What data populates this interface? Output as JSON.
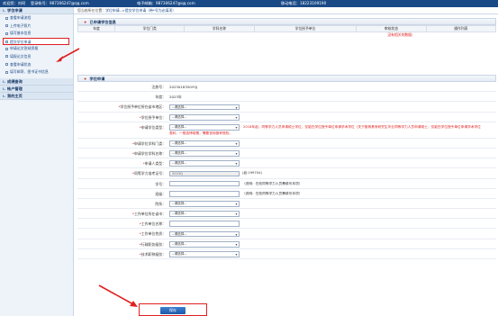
{
  "topbar": {
    "welcome": "欢迎您：刘珂",
    "account": "登录帐号：987306247@qq.com",
    "email": "电子邮箱：987306247@qq.com",
    "phone": "移动电话：18223109190"
  },
  "sidebar": {
    "sections": [
      {
        "label": "学位申请"
      },
      {
        "label": "成绩查询"
      },
      {
        "label": "帐户管理"
      },
      {
        "label": "我的主页"
      }
    ],
    "items": [
      {
        "label": "查看申请流程"
      },
      {
        "label": "上传电子照片"
      },
      {
        "label": "填写基本信息"
      },
      {
        "label": "提交学位申请"
      },
      {
        "label": "申请论文答辩资格"
      },
      {
        "label": "填报论文信息"
      },
      {
        "label": "查看申请状态"
      },
      {
        "label": "填写邮寄、图书证书信息"
      }
    ]
  },
  "breadcrumb": {
    "prefix": "您当前所在位置：",
    "path": "学位申请-->提交学位申请（带*号为必填项）"
  },
  "applied_panel": {
    "title": "已申请学位信息",
    "columns": [
      "年度",
      "学位门类",
      "学科名称",
      "学位授予单位",
      "审核状态",
      "操作列表"
    ],
    "empty_text": "没有相关的数据!"
  },
  "form": {
    "title": "学位申请",
    "fields": [
      {
        "label": "注册号：",
        "required": false,
        "value": "2023018350YQJ"
      },
      {
        "label": "年度：",
        "required": false,
        "value": "2023年"
      },
      {
        "label": "学位授予单位所在省市地区：",
        "required": true,
        "select": "--请选择--"
      },
      {
        "label": "学位授予单位：",
        "required": true,
        "select": "--请选择--"
      },
      {
        "label": "申请学位类型：",
        "required": true,
        "select": "--请选择--",
        "warn": "2016年起，同等学力人员申请硕士学位，仅能在学位授予单位申请学术学位（关于推荐具有研究生毕业同等学力人员申请硕士、仅能在学位授予单位申请学术学位",
        "warn2": "表科，一般选择硕费，需要咨询报考院校。"
      },
      {
        "label": "申请学位学科门类：",
        "required": true,
        "select": "--请选择--"
      },
      {
        "label": "申请学位学科名称：",
        "required": true,
        "select": "--请选择--"
      },
      {
        "label": "申请人类型：",
        "required": true,
        "select": "--请选择--"
      },
      {
        "label": "同等学力准考证号：",
        "required": true,
        "input": "2023Q",
        "hint": "(如:199704)"
      },
      {
        "label": "学号：",
        "required": false,
        "input": "",
        "hint": "（说明：在校同等学力人员需填写本项）"
      },
      {
        "label": "班级：",
        "required": false,
        "input": "",
        "hint": "（说明：在校同等学力人员需填写本项）"
      },
      {
        "label": "院系：",
        "required": false,
        "select": "--请选择--"
      },
      {
        "label": "工作单位所在省市：",
        "required": true,
        "select": "--请选择--"
      },
      {
        "label": "工作单位名称：",
        "required": true,
        "input": ""
      },
      {
        "label": "工作单位性质：",
        "required": true,
        "select": "--请选择--"
      },
      {
        "label": "行政职务级别：",
        "required": true,
        "select": "--请选择--"
      },
      {
        "label": "技术职称级别：",
        "required": true,
        "select": "--请选择--"
      }
    ],
    "save_label": "保存"
  },
  "colors": {
    "header": "#1a4a86",
    "annotation": "#e02020"
  }
}
